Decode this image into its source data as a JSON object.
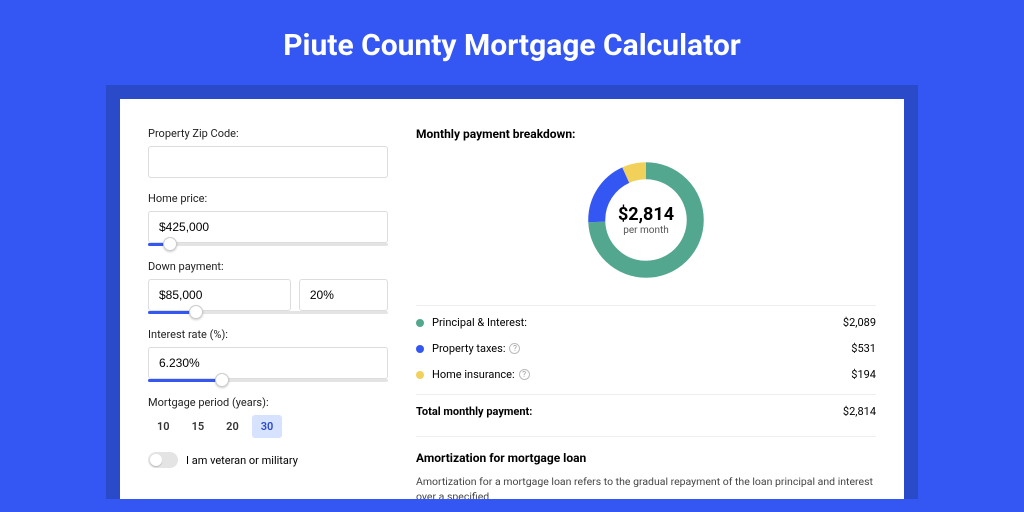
{
  "title": "Piute County Mortgage Calculator",
  "form": {
    "zip_label": "Property Zip Code:",
    "zip_value": "",
    "price_label": "Home price:",
    "price_value": "$425,000",
    "price_slider_pct": 9,
    "down_label": "Down payment:",
    "down_value": "$85,000",
    "down_pct_value": "20%",
    "down_slider_pct": 20,
    "rate_label": "Interest rate (%):",
    "rate_value": "6.230%",
    "rate_slider_pct": 31,
    "period_label": "Mortgage period (years):",
    "periods": [
      "10",
      "15",
      "20",
      "30"
    ],
    "period_selected": "30",
    "veteran_label": "I am veteran or military"
  },
  "breakdown": {
    "heading": "Monthly payment breakdown:",
    "center_amount": "$2,814",
    "center_sub": "per month",
    "items": [
      {
        "label": "Principal & Interest:",
        "value": "$2,089",
        "color": "#54a78f",
        "num": 2089,
        "help": false
      },
      {
        "label": "Property taxes:",
        "value": "$531",
        "color": "#3457f3",
        "num": 531,
        "help": true
      },
      {
        "label": "Home insurance:",
        "value": "$194",
        "color": "#f1d15a",
        "num": 194,
        "help": true
      }
    ],
    "total_label": "Total monthly payment:",
    "total_value": "$2,814"
  },
  "amort": {
    "heading": "Amortization for mortgage loan",
    "body": "Amortization for a mortgage loan refers to the gradual repayment of the loan principal and interest over a specified"
  },
  "chart_data": {
    "type": "pie",
    "title": "Monthly payment breakdown",
    "categories": [
      "Principal & Interest",
      "Property taxes",
      "Home insurance"
    ],
    "values": [
      2089,
      531,
      194
    ],
    "colors": [
      "#54a78f",
      "#3457f3",
      "#f1d15a"
    ],
    "center_label": "$2,814 per month"
  }
}
